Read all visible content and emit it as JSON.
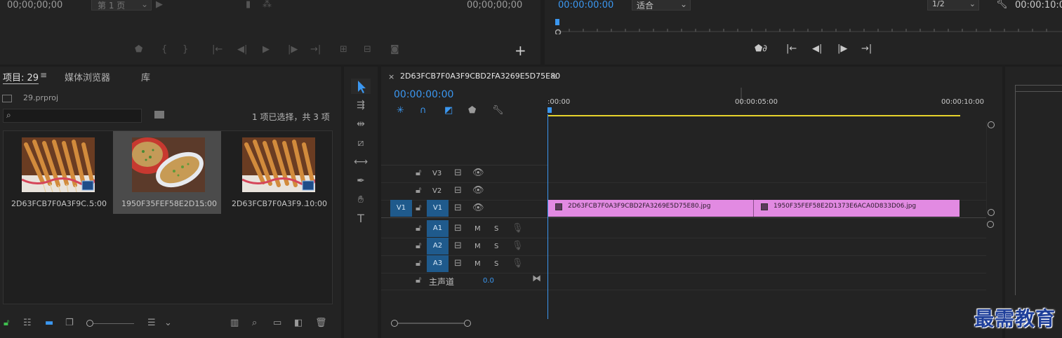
{
  "source_monitor": {
    "timecode_left": "00;00;00;00",
    "page_select": "第 1 页",
    "timecode_right": "00;00;00;00",
    "add_button": "+"
  },
  "program_monitor": {
    "timecode": "00:00:00:00",
    "fit_select": "适合",
    "resolution_select": "1/2",
    "timecode_right": "00:00:10:0"
  },
  "project": {
    "tab_project": "项目: 29",
    "tab_media_browser": "媒体浏览器",
    "tab_library": "库",
    "file_name": "29.prproj",
    "search_placeholder": "",
    "selection_status": "1 项已选择，共 3 项",
    "items": [
      {
        "name": "2D63FCB7F0A3F9C...",
        "duration": "5:00"
      },
      {
        "name": "1950F35FEF58E2D1...",
        "duration": "5:00"
      },
      {
        "name": "2D63FCB7F0A3F9...",
        "duration": "10:00"
      }
    ]
  },
  "timeline": {
    "sequence_name": "2D63FCB7F0A3F9CBD2FA3269E5D75E80",
    "close_label": "×",
    "timecode": "00:00:00:00",
    "ruler": [
      ":00:00",
      "00:00:05:00",
      "00:00:10:00"
    ],
    "video_tracks": [
      {
        "label": "V3"
      },
      {
        "label": "V2"
      },
      {
        "label": "V1",
        "source": "V1"
      }
    ],
    "audio_tracks": [
      {
        "label": "A1",
        "m": "M",
        "s": "S"
      },
      {
        "label": "A2",
        "m": "M",
        "s": "S"
      },
      {
        "label": "A3",
        "m": "M",
        "s": "S"
      }
    ],
    "master_label": "主声道",
    "master_value": "0.0",
    "clips": [
      {
        "name": "2D63FCB7F0A3F9CBD2FA3269E5D75E80.jpg"
      },
      {
        "name": "1950F35FEF58E2D1373E6ACA0D833D06.jpg"
      }
    ],
    "clip_color": "#e28ae2"
  },
  "watermark": "最需教育",
  "colors": {
    "accent": "#3b97f0",
    "track_blue": "#1f5a8c",
    "playhead": "#3b97f0",
    "workarea": "#e7d32c"
  }
}
